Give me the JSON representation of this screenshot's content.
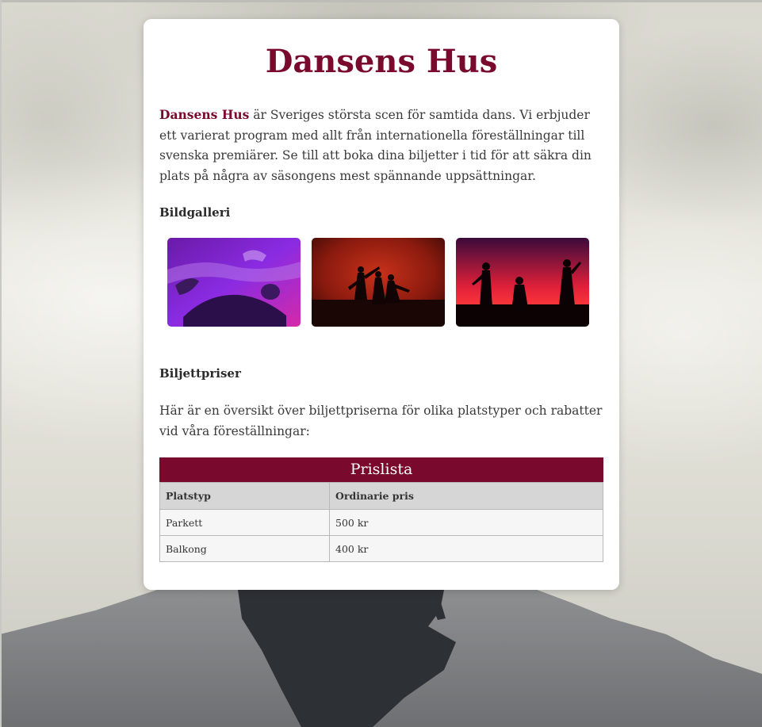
{
  "page": {
    "title": "Dansens Hus",
    "intro_brand": "Dansens Hus",
    "intro_text": " är Sveriges största scen för samtida dans. Vi erbjuder ett varierat program med allt från internationella föreställningar till svenska premiärer. Se till att boka dina biljetter i tid för att säkra din plats på några av säsongens mest spännande uppsättningar.",
    "gallery_heading": "Bildgalleri",
    "prices_heading": "Biljettpriser",
    "prices_text": "Här är en översikt över biljettpriserna för olika platstyper och rabatter vid våra föreställningar:"
  },
  "price_table": {
    "caption": "Prislista",
    "headers": [
      "Platstyp",
      "Ordinarie pris"
    ],
    "rows": [
      [
        "Parkett",
        "500 kr"
      ],
      [
        "Balkong",
        "400 kr"
      ]
    ]
  },
  "colors": {
    "accent": "#7a0a2d",
    "header_bg": "#d6d6d6"
  }
}
